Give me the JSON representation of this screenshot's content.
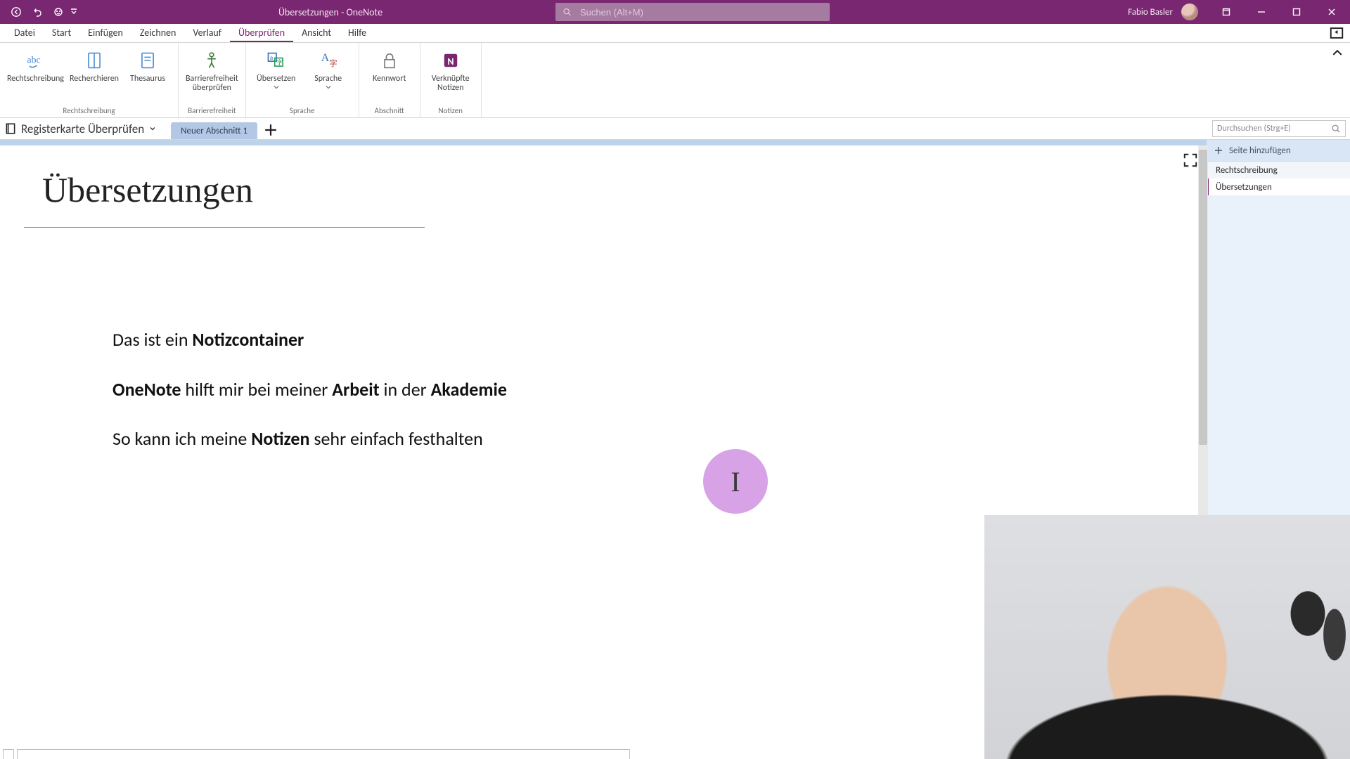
{
  "app": {
    "title": "Übersetzungen  -  OneNote",
    "user": "Fabio Basler",
    "search_placeholder": "Suchen (Alt+M)"
  },
  "menu": {
    "items": [
      "Datei",
      "Start",
      "Einfügen",
      "Zeichnen",
      "Verlauf",
      "Überprüfen",
      "Ansicht",
      "Hilfe"
    ],
    "active_index": 5
  },
  "ribbon": {
    "groups": [
      {
        "name": "Rechtschreibung",
        "buttons": [
          {
            "id": "spelling",
            "label1": "Rechtschreibung",
            "icon": "abc"
          },
          {
            "id": "research",
            "label1": "Recherchieren",
            "icon": "book"
          },
          {
            "id": "thesaurus",
            "label1": "Thesaurus",
            "icon": "book2"
          }
        ]
      },
      {
        "name": "Barrierefreiheit",
        "buttons": [
          {
            "id": "a11y",
            "label1": "Barrierefreiheit",
            "label2": "überprüfen",
            "icon": "a11y"
          }
        ]
      },
      {
        "name": "Sprache",
        "buttons": [
          {
            "id": "translate",
            "label1": "Übersetzen",
            "icon": "translate",
            "dropdown": true
          },
          {
            "id": "language",
            "label1": "Sprache",
            "icon": "language",
            "dropdown": true
          }
        ]
      },
      {
        "name": "Abschnitt",
        "buttons": [
          {
            "id": "password",
            "label1": "Kennwort",
            "icon": "lock"
          }
        ]
      },
      {
        "name": "Notizen",
        "buttons": [
          {
            "id": "linked",
            "label1": "Verknüpfte",
            "label2": "Notizen",
            "icon": "onenote"
          }
        ]
      }
    ]
  },
  "navigation": {
    "notebook": "Registerkarte Überprüfen",
    "section_tab": "Neuer Abschnitt 1",
    "local_search_placeholder": "Durchsuchen (Strg+E)"
  },
  "page": {
    "title": "Übersetzungen",
    "lines": [
      {
        "segments": [
          {
            "t": "Das ist ein ",
            "b": false
          },
          {
            "t": "Notizcontainer",
            "b": true
          }
        ]
      },
      {
        "segments": [
          {
            "t": "OneNote",
            "b": true
          },
          {
            "t": " hilft mir bei meiner ",
            "b": false
          },
          {
            "t": "Arbeit",
            "b": true
          },
          {
            "t": " in der ",
            "b": false
          },
          {
            "t": "Akademie",
            "b": true
          }
        ]
      },
      {
        "segments": [
          {
            "t": "So kann ich meine ",
            "b": false
          },
          {
            "t": "Notizen",
            "b": true
          },
          {
            "t": " sehr einfach festhalten",
            "b": false
          }
        ]
      }
    ]
  },
  "pages_panel": {
    "add_label": "Seite hinzufügen",
    "items": [
      "Rechtschreibung",
      "Übersetzungen"
    ],
    "selected_index": 1
  },
  "cursor_glyph": "I"
}
